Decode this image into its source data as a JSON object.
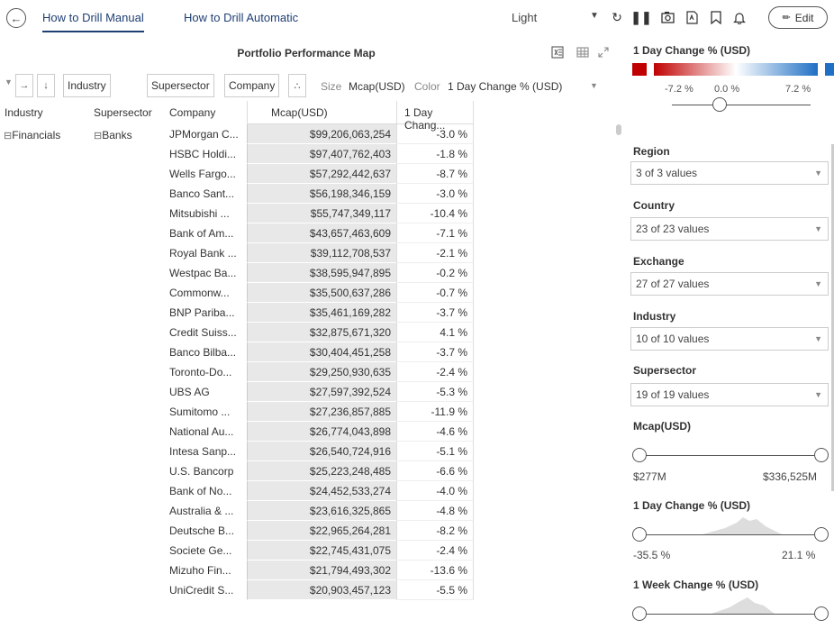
{
  "topbar": {
    "tabs": [
      "How to Drill Manual",
      "How to Drill Automatic"
    ],
    "theme": "Light",
    "edit_label": "Edit"
  },
  "visual": {
    "title": "Portfolio Performance Map",
    "drill_chips": [
      "Industry",
      "Supersector",
      "Company"
    ],
    "size_label": "Size",
    "size_value": "Mcap(USD)",
    "color_label": "Color",
    "color_value": "1 Day Change % (USD)"
  },
  "table": {
    "headers": [
      "Industry",
      "Supersector",
      "Company",
      "Mcap(USD)",
      "1 Day Chang..."
    ],
    "industry": "Financials",
    "supersector": "Banks",
    "rows": [
      {
        "company": "JPMorgan C...",
        "mcap": "$99,206,063,254",
        "chg": "-3.0 %"
      },
      {
        "company": "HSBC Holdi...",
        "mcap": "$97,407,762,403",
        "chg": "-1.8 %"
      },
      {
        "company": "Wells Fargo...",
        "mcap": "$57,292,442,637",
        "chg": "-8.7 %"
      },
      {
        "company": "Banco Sant...",
        "mcap": "$56,198,346,159",
        "chg": "-3.0 %"
      },
      {
        "company": "Mitsubishi ...",
        "mcap": "$55,747,349,117",
        "chg": "-10.4 %"
      },
      {
        "company": "Bank of Am...",
        "mcap": "$43,657,463,609",
        "chg": "-7.1 %"
      },
      {
        "company": "Royal Bank ...",
        "mcap": "$39,112,708,537",
        "chg": "-2.1 %"
      },
      {
        "company": "Westpac Ba...",
        "mcap": "$38,595,947,895",
        "chg": "-0.2 %"
      },
      {
        "company": "Commonw...",
        "mcap": "$35,500,637,286",
        "chg": "-0.7 %"
      },
      {
        "company": "BNP Pariba...",
        "mcap": "$35,461,169,282",
        "chg": "-3.7 %"
      },
      {
        "company": "Credit Suiss...",
        "mcap": "$32,875,671,320",
        "chg": "4.1 %"
      },
      {
        "company": "Banco Bilba...",
        "mcap": "$30,404,451,258",
        "chg": "-3.7 %"
      },
      {
        "company": "Toronto-Do...",
        "mcap": "$29,250,930,635",
        "chg": "-2.4 %"
      },
      {
        "company": "UBS AG",
        "mcap": "$27,597,392,524",
        "chg": "-5.3 %"
      },
      {
        "company": "Sumitomo ...",
        "mcap": "$27,236,857,885",
        "chg": "-11.9 %"
      },
      {
        "company": "National Au...",
        "mcap": "$26,774,043,898",
        "chg": "-4.6 %"
      },
      {
        "company": "Intesa Sanp...",
        "mcap": "$26,540,724,916",
        "chg": "-5.1 %"
      },
      {
        "company": "U.S. Bancorp",
        "mcap": "$25,223,248,485",
        "chg": "-6.6 %"
      },
      {
        "company": "Bank of No...",
        "mcap": "$24,452,533,274",
        "chg": "-4.0 %"
      },
      {
        "company": "Australia & ...",
        "mcap": "$23,616,325,865",
        "chg": "-4.8 %"
      },
      {
        "company": "Deutsche B...",
        "mcap": "$22,965,264,281",
        "chg": "-8.2 %"
      },
      {
        "company": "Societe Ge...",
        "mcap": "$22,745,431,075",
        "chg": "-2.4 %"
      },
      {
        "company": "Mizuho Fin...",
        "mcap": "$21,794,493,302",
        "chg": "-13.6 %"
      },
      {
        "company": "UniCredit S...",
        "mcap": "$20,903,457,123",
        "chg": "-5.5 %"
      }
    ]
  },
  "legend": {
    "title": "1 Day Change % (USD)",
    "min": "-7.2 %",
    "mid": "0.0 %",
    "max": "7.2 %",
    "colors": {
      "negative": "#c00000",
      "positive": "#1f6fc4"
    }
  },
  "filters": {
    "region": {
      "title": "Region",
      "value": "3 of 3 values"
    },
    "country": {
      "title": "Country",
      "value": "23 of 23 values"
    },
    "exchange": {
      "title": "Exchange",
      "value": "27 of 27 values"
    },
    "industry": {
      "title": "Industry",
      "value": "10 of 10 values"
    },
    "supersector": {
      "title": "Supersector",
      "value": "19 of 19 values"
    },
    "mcap": {
      "title": "Mcap(USD)",
      "min": "$277M",
      "max": "$336,525M"
    },
    "day_change": {
      "title": "1 Day Change % (USD)",
      "min": "-35.5 %",
      "max": "21.1 %"
    },
    "week_change": {
      "title": "1 Week Change % (USD)"
    }
  },
  "icons": [
    "back-icon",
    "refresh-icon",
    "pause-icon",
    "snapshot-icon",
    "pdf-icon",
    "bookmark-icon",
    "bell-icon",
    "pencil-icon",
    "excel-icon",
    "table-icon",
    "expand-icon",
    "drill-in-icon",
    "drill-down-icon",
    "scatter-icon"
  ]
}
